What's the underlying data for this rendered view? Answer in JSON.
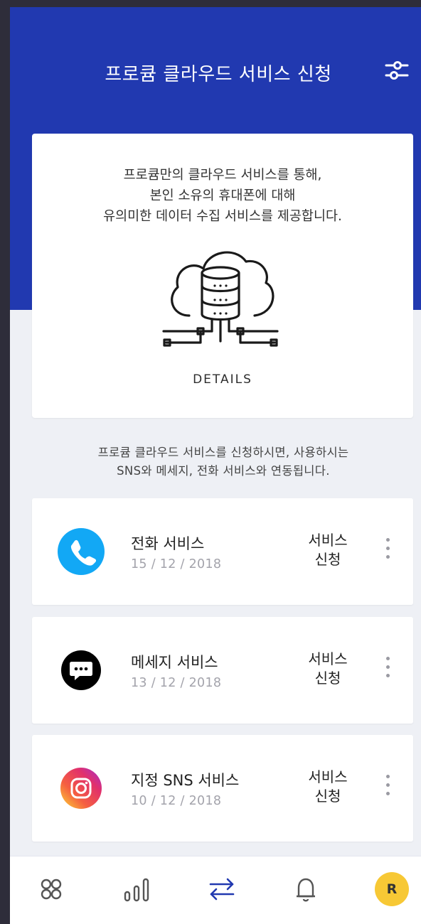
{
  "header": {
    "title": "프로큠 클라우드 서비스 신청",
    "filter_icon": "sliders-icon",
    "background": "#2139b0"
  },
  "intro": {
    "lines": [
      "프로큠만의 클라우드 서비스를 통해,",
      "본인 소유의 휴대폰에 대해",
      "유의미한 데이터 수집 서비스를 제공합니다."
    ],
    "illustration_icon": "cloud-database-icon",
    "details_label": "DETAILS"
  },
  "notice": {
    "lines": [
      "프로큠 클라우드 서비스를 신청하시면, 사용하시는",
      "SNS와 메세지, 전화 서비스와 연동됩니다."
    ]
  },
  "services": [
    {
      "name": "전화 서비스",
      "date": "15 / 12 / 2018",
      "action_lines": [
        "서비스",
        "신청"
      ],
      "icon": "phone-icon",
      "icon_color": "#12a8f5"
    },
    {
      "name": "메세지 서비스",
      "date": "13 / 12 / 2018",
      "action_lines": [
        "서비스",
        "신청"
      ],
      "icon": "message-icon",
      "icon_color": "#000000"
    },
    {
      "name": "지정 SNS 서비스",
      "date": "10 / 12 / 2018",
      "action_lines": [
        "서비스",
        "신청"
      ],
      "icon": "instagram-icon",
      "icon_color": "#e1306c"
    }
  ],
  "bottom_nav": {
    "items": [
      {
        "icon": "grid-icon",
        "active": false
      },
      {
        "icon": "bar-chart-icon",
        "active": false
      },
      {
        "icon": "swap-arrows-icon",
        "active": true
      },
      {
        "icon": "bell-icon",
        "active": false
      }
    ],
    "avatar_initial": "R",
    "avatar_color": "#f7c835",
    "active_color": "#2139b0"
  }
}
